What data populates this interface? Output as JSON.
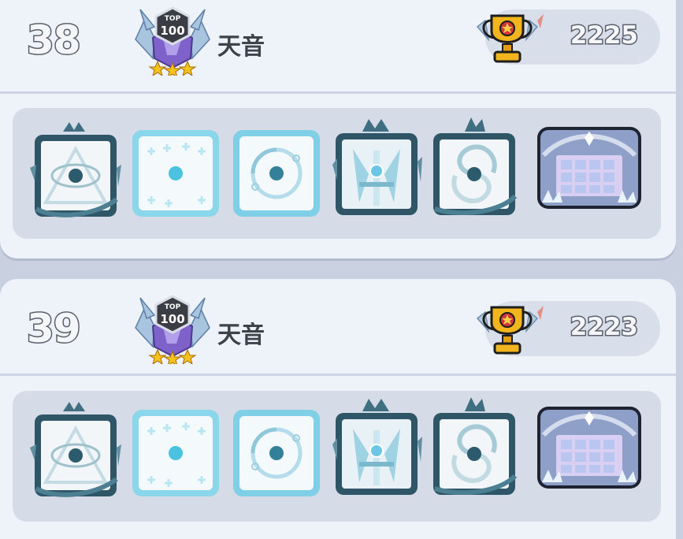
{
  "entries": [
    {
      "rank": "38",
      "badge_text": [
        "TOP",
        "100"
      ],
      "name": "天音",
      "score": "2225",
      "deck": [
        "eye-dice-icon",
        "plus-dice-icon",
        "orbit-dice-icon",
        "sword-dice-icon",
        "vortex-dice-icon",
        "crystal-board-icon"
      ]
    },
    {
      "rank": "39",
      "badge_text": [
        "TOP",
        "100"
      ],
      "name": "天音",
      "score": "2223",
      "deck": [
        "eye-dice-icon",
        "plus-dice-icon",
        "orbit-dice-icon",
        "sword-dice-icon",
        "vortex-dice-icon",
        "crystal-board-icon"
      ]
    }
  ],
  "colors": {
    "frame_dark": "#2f5c6d",
    "ice": "#7ad3e8",
    "gold": "#f2b51d"
  }
}
